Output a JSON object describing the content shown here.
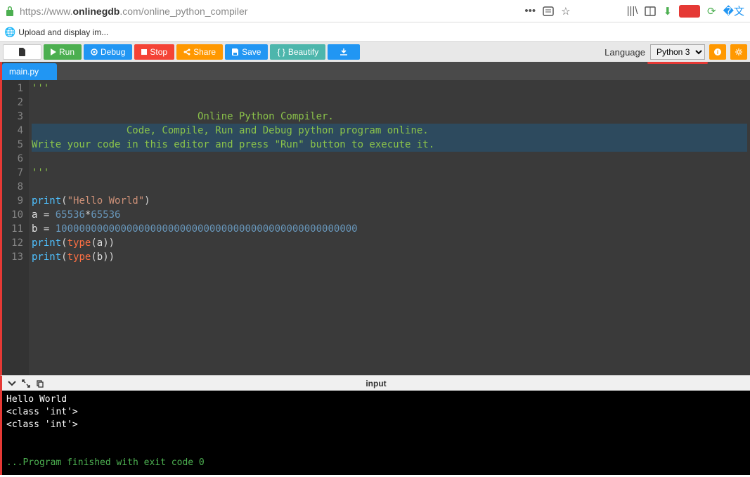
{
  "browser": {
    "url_prefix": "https://www.",
    "url_domain": "onlinegdb",
    "url_suffix": ".com/online_python_compiler",
    "tab_title": "Upload and display im..."
  },
  "toolbar": {
    "run": "Run",
    "debug": "Debug",
    "stop": "Stop",
    "share": "Share",
    "save": "Save",
    "beautify": "Beautify",
    "language_label": "Language",
    "language_value": "Python 3"
  },
  "file_tab": "main.py",
  "code": {
    "lines": [
      {
        "n": 1,
        "type": "com",
        "text": "'''"
      },
      {
        "n": 2,
        "type": "com",
        "text": ""
      },
      {
        "n": 3,
        "type": "com",
        "text": "                            Online Python Compiler."
      },
      {
        "n": 4,
        "type": "com",
        "text": "                Code, Compile, Run and Debug python program online.",
        "hl": true
      },
      {
        "n": 5,
        "type": "com",
        "text": "Write your code in this editor and press \"Run\" button to execute it.",
        "hl": true
      },
      {
        "n": 6,
        "type": "com",
        "text": ""
      },
      {
        "n": 7,
        "type": "com",
        "text": "'''"
      },
      {
        "n": 8,
        "type": "blank",
        "text": ""
      },
      {
        "n": 9,
        "type": "print_str",
        "fn": "print",
        "str": "\"Hello World\""
      },
      {
        "n": 10,
        "type": "assign_mul",
        "id": "a",
        "l": "65536",
        "r": "65536"
      },
      {
        "n": 11,
        "type": "assign_num",
        "id": "b",
        "num": "100000000000000000000000000000000000000000000000000"
      },
      {
        "n": 12,
        "type": "print_type",
        "fn": "print",
        "kw": "type",
        "id": "a"
      },
      {
        "n": 13,
        "type": "print_type",
        "fn": "print",
        "kw": "type",
        "id": "b"
      }
    ]
  },
  "output_title": "input",
  "console": {
    "l1": "Hello World",
    "l2": "<class 'int'>",
    "l3": "<class 'int'>",
    "exit": "...Program finished with exit code 0"
  }
}
